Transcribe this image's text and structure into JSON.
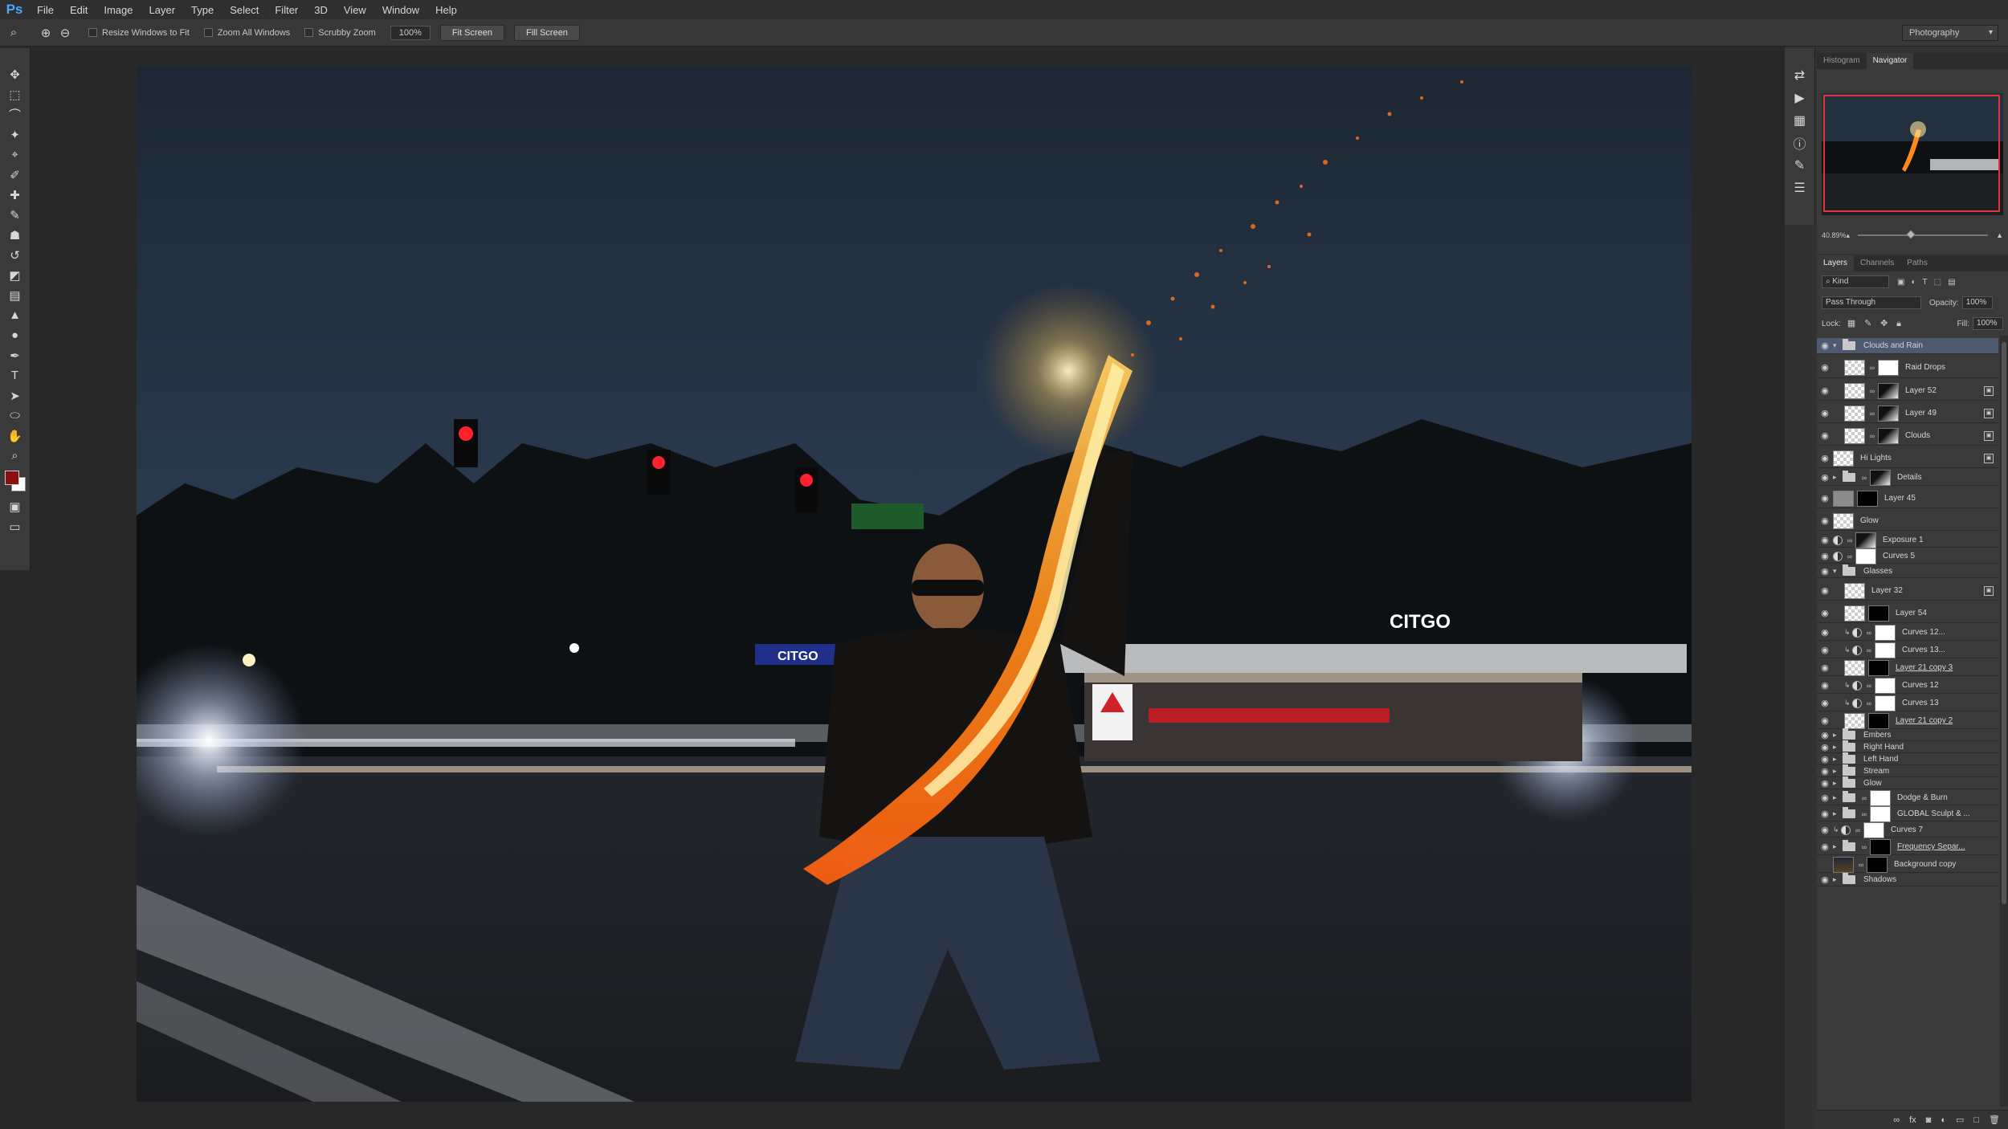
{
  "app": {
    "logo": "Ps"
  },
  "menu": [
    "File",
    "Edit",
    "Image",
    "Layer",
    "Type",
    "Select",
    "Filter",
    "3D",
    "View",
    "Window",
    "Help"
  ],
  "options": {
    "resize_windows": "Resize Windows to Fit",
    "zoom_all": "Zoom All Windows",
    "scrubby": "Scrubby Zoom",
    "zoom_value": "100%",
    "fit_screen": "Fit Screen",
    "fill_screen": "Fill Screen",
    "workspace": "Photography"
  },
  "navigator": {
    "tabs": [
      "Histogram",
      "Navigator"
    ],
    "zoom": "40.89%"
  },
  "photo_signs": {
    "citgo_top": "CITGO",
    "citgo_left": "CITGO"
  },
  "layers_panel": {
    "tabs": [
      "Layers",
      "Channels",
      "Paths"
    ],
    "filter_kind": "Kind",
    "blend_mode": "Pass Through",
    "opacity_label": "Opacity:",
    "opacity": "100%",
    "lock_label": "Lock:",
    "fill_label": "Fill:",
    "fill": "100%",
    "layers": [
      "Clouds and Rain",
      "Raid Drops",
      "Layer 52",
      "Layer 49",
      "Clouds",
      "Hi Lights",
      "Details",
      "Layer 45",
      "Glow",
      "Exposure 1",
      "Curves 5",
      "Glasses",
      "Layer 32",
      "Layer 54",
      "Curves 12...",
      "Curves 13...",
      "Layer 21 copy 3",
      "Curves 12",
      "Curves 13",
      "Layer 21 copy 2",
      "Embers",
      "Right Hand",
      "Left Hand",
      "Stream",
      "Glow",
      "Dodge & Burn",
      "GLOBAL Sculpt & ...",
      "Curves 7",
      "Frequency Separ...",
      "Background copy",
      "Shadows"
    ]
  },
  "colors": {
    "accent": "#49a9ff",
    "selected_layer": "#4d5a70",
    "navigator_view": "#e0343a",
    "foreground": "#8a1010"
  },
  "icons": [
    "zoom-icon",
    "zoom-in-icon",
    "zoom-out-icon",
    "move-icon",
    "marquee-icon",
    "lasso-icon",
    "magic-wand-icon",
    "crop-icon",
    "eyedropper-icon",
    "healing-icon",
    "brush-icon",
    "stamp-icon",
    "history-brush-icon",
    "eraser-icon",
    "gradient-icon",
    "blur-icon",
    "dodge-icon",
    "pen-icon",
    "type-icon",
    "path-select-icon",
    "shape-icon",
    "hand-icon",
    "zoom-tool-icon",
    "eye-icon",
    "folder-icon",
    "chain-icon"
  ]
}
